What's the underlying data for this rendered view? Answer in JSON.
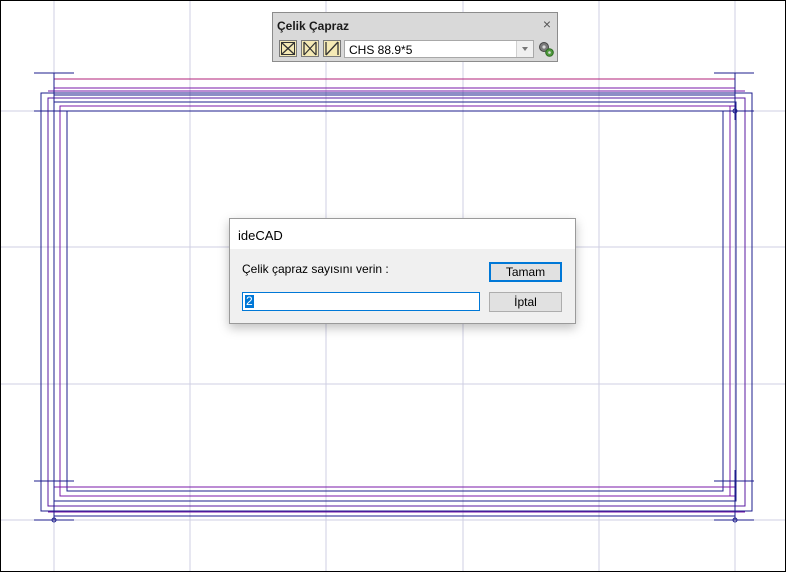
{
  "toolbar": {
    "title": "Çelik Çapraz",
    "close_glyph": "×",
    "buttons": [
      "x-brace-icon",
      "k-brace-icon",
      "diagonal-brace-icon"
    ],
    "section_value": "CHS 88.9*5",
    "settings_icon": "gears-icon"
  },
  "dialog": {
    "title": "ideCAD",
    "prompt": "Çelik çapraz sayısını verin :",
    "input_value": "2",
    "ok_label": "Tamam",
    "cancel_label": "İptal"
  },
  "colors": {
    "grid": "#c9c9de",
    "frame_blue": "#1c1c8c",
    "frame_purple": "#7a1aa8",
    "frame_magenta": "#b0207a",
    "accent": "#0078d7"
  }
}
